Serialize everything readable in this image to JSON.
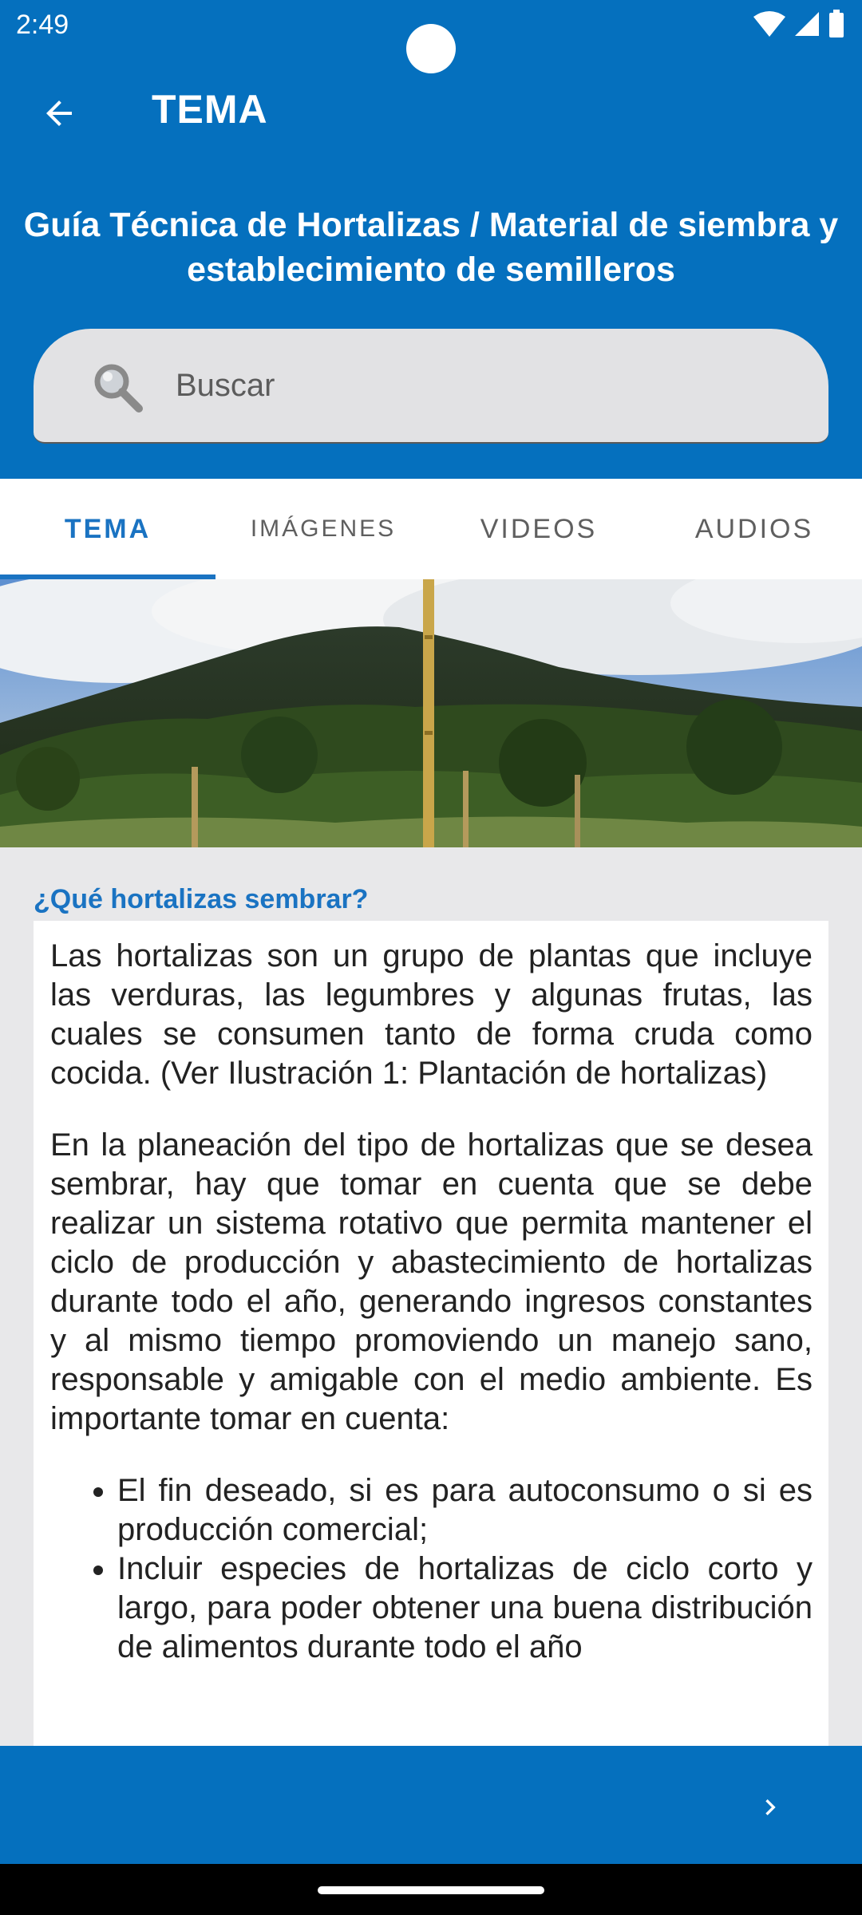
{
  "status_bar": {
    "time": "2:49"
  },
  "app_bar": {
    "title": "TEMA"
  },
  "guide": {
    "title": "Guía Técnica de Hortalizas / Material de siembra y establecimiento de semilleros"
  },
  "search": {
    "placeholder": "Buscar"
  },
  "tabs": [
    {
      "label": "TEMA",
      "active": true
    },
    {
      "label": "IMÁGENES",
      "active": false
    },
    {
      "label": "VIDEOS",
      "active": false
    },
    {
      "label": "AUDIOS",
      "active": false
    }
  ],
  "content": {
    "section_title": "¿Qué hortalizas sembrar?",
    "paragraphs": [
      "Las hortalizas son un grupo de plantas que incluye las verduras, las legumbres y algunas frutas, las cuales se consumen tanto de forma cruda como cocida. (Ver Ilustración 1: Plantación de hortalizas)",
      "En la planeación del tipo de hortalizas que se desea sembrar, hay que tomar en cuenta que se debe realizar un sistema rotativo que permita mantener el ciclo de producción y abastecimiento de hortalizas durante todo el año, generando ingresos constantes y al mismo tiempo promoviendo un manejo sano, responsable y amigable con el medio ambiente. Es importante tomar en cuenta:"
    ],
    "bullets": [
      "El fin deseado, si es para autoconsumo o si es producción comercial;",
      "Incluir especies de hortalizas de ciclo corto y largo, para poder obtener una buena distribución de alimentos durante todo el año"
    ]
  },
  "icons": {
    "back": "arrow-back-icon",
    "search": "magnifier-icon",
    "next": "chevron-right-icon"
  },
  "colors": {
    "primary": "#0570be",
    "accent": "#1a73c2",
    "content_bg": "#e8e8ea"
  }
}
